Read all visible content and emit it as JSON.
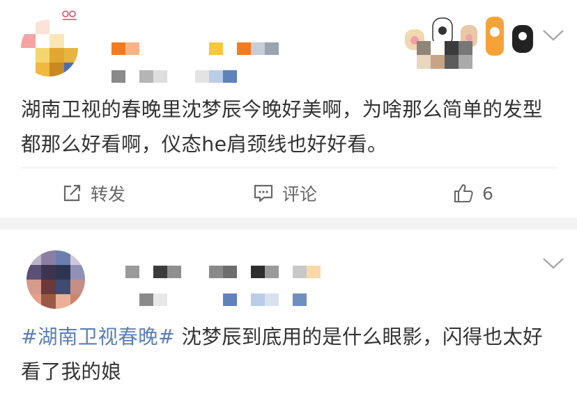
{
  "posts": [
    {
      "text": "湖南卫视的春晚里沈梦辰今晚好美啊，为啥那么简单的发型都那么好看啊，仪态he肩颈线也好好看。",
      "actions": {
        "repost_label": "转发",
        "comment_label": "评论",
        "like_count": "6"
      },
      "icons": [
        "repost-icon",
        "comment-icon",
        "thumbs-up-icon",
        "chevron-down-icon",
        "cat-paws-decoration"
      ]
    },
    {
      "hashtag": "#湖南卫视春晚#",
      "text": " 沈梦辰到底用的是什么眼影，闪得也太好看了我的娘",
      "icons": [
        "chevron-down-icon"
      ]
    }
  ],
  "colors": {
    "hashtag": "#5b7fb5",
    "text": "#333333",
    "action_text": "#666666",
    "divider": "#e6e6e6",
    "background": "#f2f2f2"
  }
}
